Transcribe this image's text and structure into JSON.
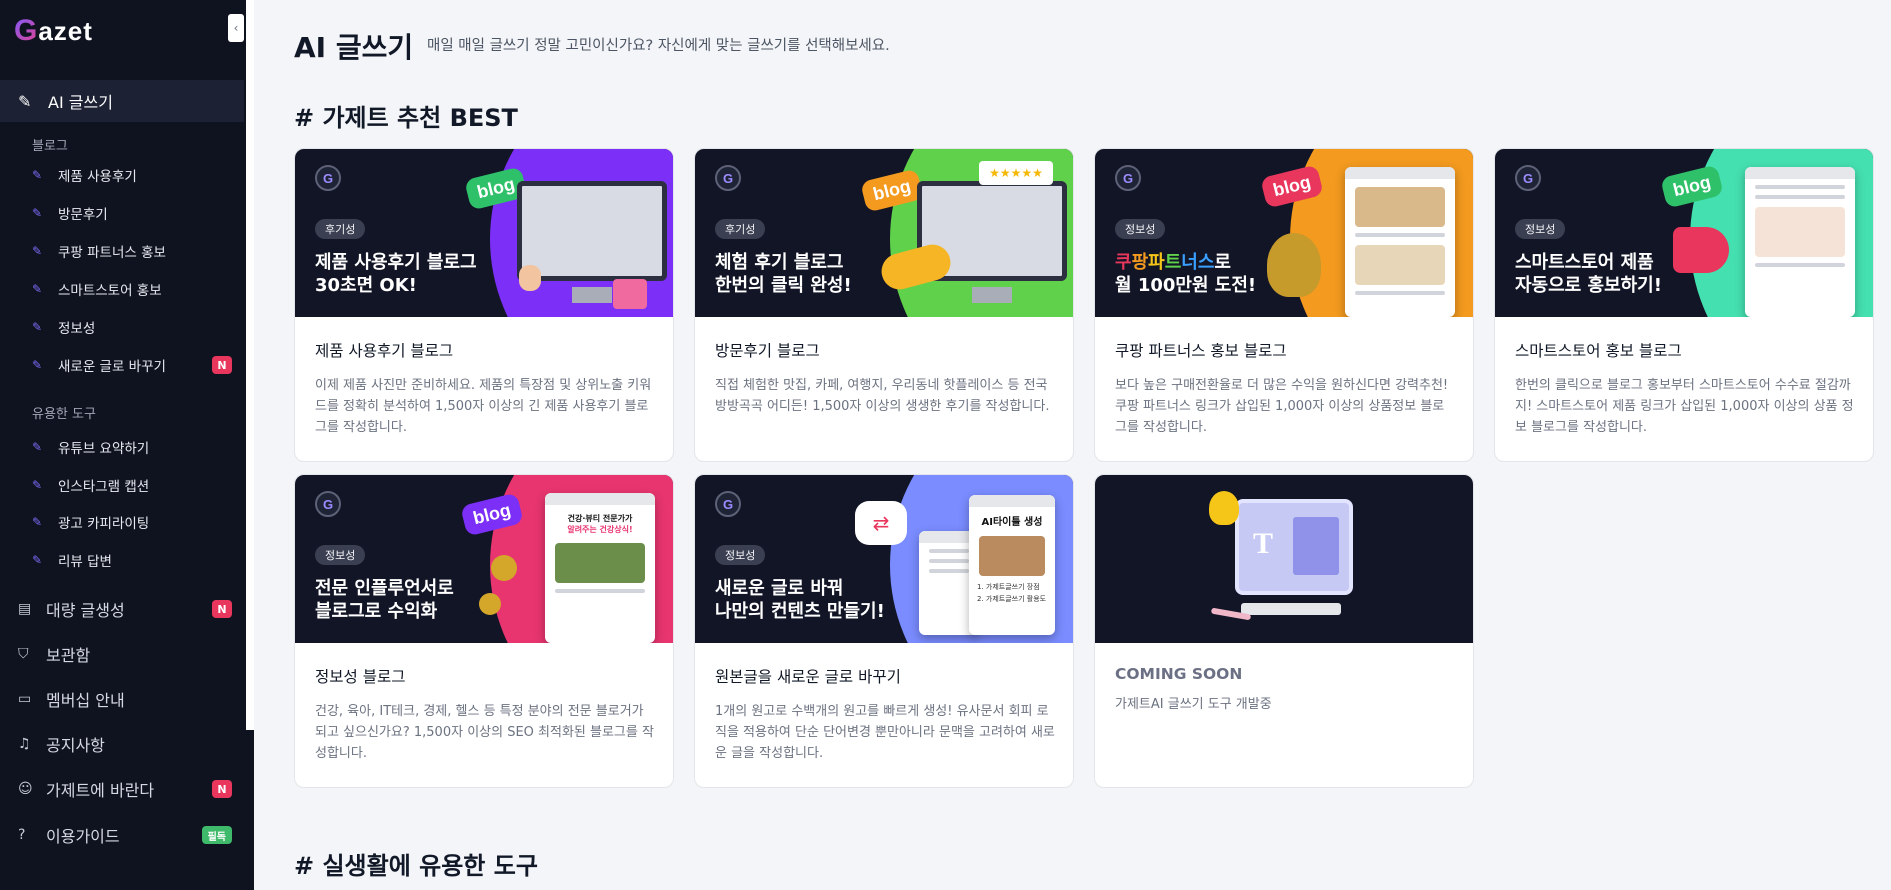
{
  "app": {
    "logo_initial": "G",
    "logo_rest": "azet"
  },
  "sidebar": {
    "active": {
      "label": "AI 글쓰기"
    },
    "blog_section": {
      "label": "블로그",
      "items": [
        {
          "label": "제품 사용후기",
          "badge": ""
        },
        {
          "label": "방문후기",
          "badge": ""
        },
        {
          "label": "쿠팡 파트너스 홍보",
          "badge": ""
        },
        {
          "label": "스마트스토어 홍보",
          "badge": ""
        },
        {
          "label": "정보성",
          "badge": ""
        },
        {
          "label": "새로운 글로 바꾸기",
          "badge": "N"
        }
      ]
    },
    "tools_section": {
      "label": "유용한 도구",
      "items": [
        {
          "label": "유튜브 요약하기"
        },
        {
          "label": "인스타그램 캡션"
        },
        {
          "label": "광고 카피라이팅"
        },
        {
          "label": "리뷰 답변"
        }
      ]
    },
    "nav": [
      {
        "label": "대량 글생성",
        "badge": "N"
      },
      {
        "label": "보관함",
        "badge": ""
      },
      {
        "label": "멤버십 안내",
        "badge": ""
      },
      {
        "label": "공지사항",
        "badge": ""
      },
      {
        "label": "가제트에 바란다",
        "badge": "N"
      },
      {
        "label": "이용가이드",
        "badge": "필독"
      }
    ]
  },
  "main": {
    "title": "AI 글쓰기",
    "subtitle": "매일 매일 글쓰기 정말 고민이신가요? 자신에게 맞는 글쓰기를 선택해보세요.",
    "best_heading": "# 가제트 추천 BEST",
    "tools_heading": "# 실생활에 유용한 도구",
    "cards": [
      {
        "tag": "후기성",
        "headline_1": "제품 사용후기 블로그",
        "headline_2": "30초면 OK!",
        "blog_word": "blog",
        "title": "제품 사용후기 블로그",
        "desc": "이제 제품 사진만 준비하세요. 제품의 특장점 및 상위노출 키워드를 정확히 분석하여 1,500자 이상의 긴 제품 사용후기 블로그를 작성합니다.",
        "accent": "#7b2ff7"
      },
      {
        "tag": "후기성",
        "headline_1": "체험 후기 블로그",
        "headline_2": "한번의 클릭 완성!",
        "blog_word": "blog",
        "stars": "★★★★★",
        "title": "방문후기 블로그",
        "desc": "직접 체험한 맛집, 카페, 여행지, 우리동네 핫플레이스 등 전국 방방곡곡 어디든! 1,500자 이상의 생생한 후기를 작성합니다.",
        "accent": "#5fd14b"
      },
      {
        "tag": "정보성",
        "headline_coupang": [
          "쿠",
          "팡",
          "파",
          "트",
          "너",
          "스"
        ],
        "headline_suffix": "로",
        "headline_2": "월 100만원 도전!",
        "blog_word": "blog",
        "title": "쿠팡 파트너스 홍보 블로그",
        "desc": "보다 높은 구매전환율로 더 많은 수익을 원하신다면 강력추천! 쿠팡 파트너스 링크가 삽입된 1,000자 이상의 상품정보 블로그를 작성합니다.",
        "accent": "#f39a1f"
      },
      {
        "tag": "정보성",
        "headline_1": "스마트스토어 제품",
        "headline_2": "자동으로 홍보하기!",
        "blog_word": "blog",
        "title": "스마트스토어 홍보 블로그",
        "desc": "한번의 클릭으로 블로그 홍보부터 스마트스토어 수수료 절감까지! 스마트스토어 제품 링크가 삽입된 1,000자 이상의 상품 정보 블로그를 작성합니다.",
        "accent": "#45e0b0"
      },
      {
        "tag": "정보성",
        "headline_1": "전문 인플루언서로",
        "headline_2": "블로그로 수익화",
        "blog_word": "blog",
        "mock_title": "건강·뷰티 전문가가",
        "mock_sub": "알려주는 건강상식!",
        "title": "정보성 블로그",
        "desc": "건강, 육아, IT테크, 경제, 헬스 등 특정 분야의 전문 블로거가 되고 싶으신가요? 1,500자 이상의 SEO 최적화된 블로그를 작성합니다.",
        "accent": "#e8356f"
      },
      {
        "tag": "정보성",
        "headline_1": "새로운 글로 바꿔",
        "headline_2": "나만의 컨텐츠 만들기!",
        "mock_title": "AI타이틀 생성",
        "mock_item_1": "1. 가제트글쓰기 장점",
        "mock_item_2": "2. 가제트글쓰기 활용도",
        "title": "원본글을 새로운 글로 바꾸기",
        "desc": "1개의 원고로 수백개의 원고를 빠르게 생성! 유사문서 회피 로직을 적용하여 단순 단어변경 뿐만아니라 문맥을 고려하여 새로운 글을 작성합니다.",
        "accent": "#7a8cff"
      },
      {
        "title": "COMING SOON",
        "desc": "가제트AI 글쓰기 도구 개발중",
        "monitor_letter": "T"
      }
    ]
  }
}
